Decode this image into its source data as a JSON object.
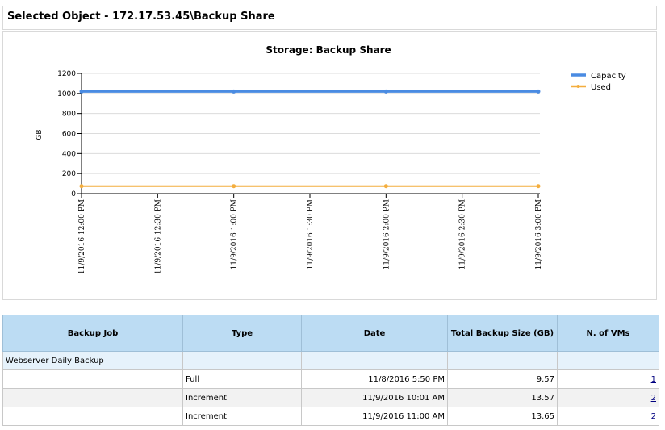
{
  "header": {
    "title": "Selected Object - 172.17.53.45\\Backup Share"
  },
  "colors": {
    "capacity": "#4a8be2",
    "used": "#f4ae3e",
    "table_header": "#bcdcf3"
  },
  "chart_data": {
    "type": "line",
    "title": "Storage: Backup Share",
    "xlabel": "",
    "ylabel": "GB",
    "ylim": [
      0,
      1200
    ],
    "yticks": [
      0,
      200,
      400,
      600,
      800,
      1000,
      1200
    ],
    "x_ticks": [
      "11/9/2016 12:00 PM",
      "11/9/2016 12:30 PM",
      "11/9/2016 1:00 PM",
      "11/9/2016 1:30 PM",
      "11/9/2016 2:00 PM",
      "11/9/2016 2:30 PM",
      "11/9/2016 3:00 PM"
    ],
    "x_points": [
      "11/9/2016 12:00 PM",
      "11/9/2016 1:00 PM",
      "11/9/2016 2:00 PM",
      "11/9/2016 3:00 PM"
    ],
    "series": [
      {
        "name": "Capacity",
        "values": [
          1020,
          1020,
          1020,
          1020
        ]
      },
      {
        "name": "Used",
        "values": [
          75,
          75,
          75,
          75
        ]
      }
    ],
    "legend_position": "top-right",
    "grid": true
  },
  "table": {
    "headers": [
      "Backup Job",
      "Type",
      "Date",
      "Total Backup Size (GB)",
      "N. of VMs"
    ],
    "group": "Webserver Daily Backup",
    "rows": [
      {
        "type": "Full",
        "date": "11/8/2016 5:50 PM",
        "size": "9.57",
        "vms": "1"
      },
      {
        "type": "Increment",
        "date": "11/9/2016 10:01 AM",
        "size": "13.57",
        "vms": "2"
      },
      {
        "type": "Increment",
        "date": "11/9/2016 11:00 AM",
        "size": "13.65",
        "vms": "2"
      }
    ]
  }
}
